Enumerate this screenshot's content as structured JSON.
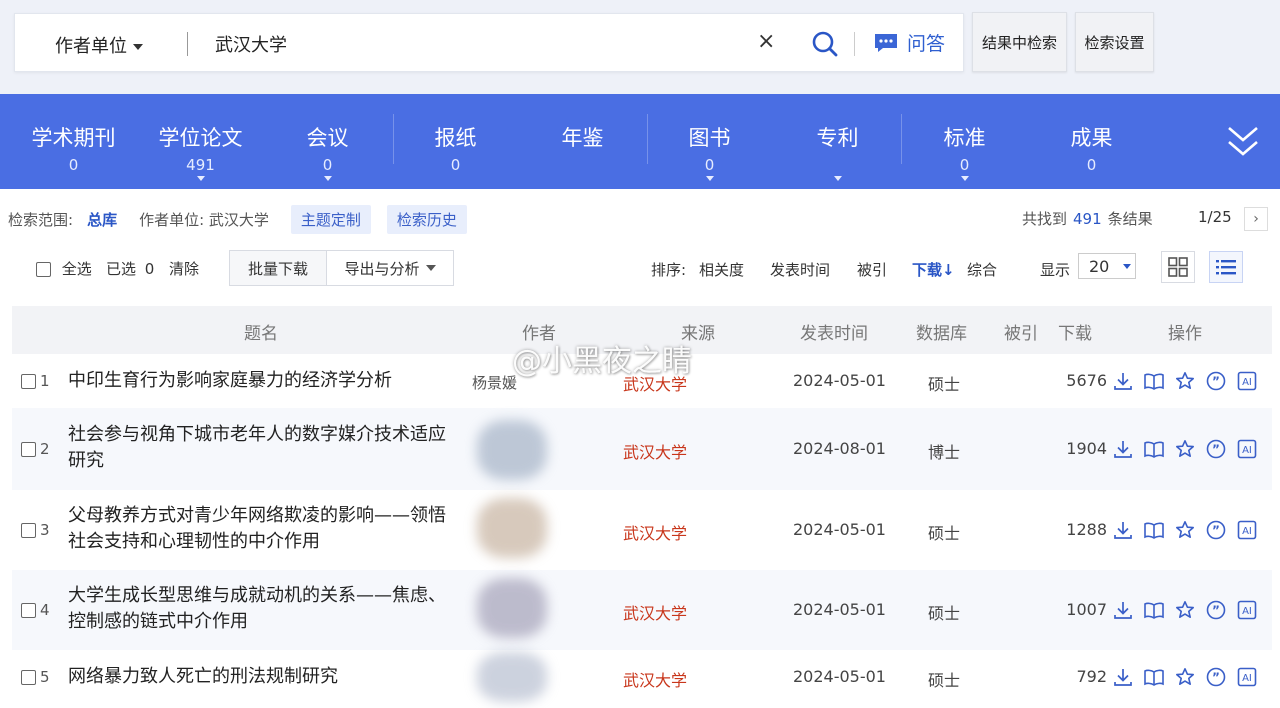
{
  "search": {
    "field": "作者单位",
    "query": "武汉大学",
    "clear_label": "×",
    "qa_label": "问答",
    "within_label": "结果中检索",
    "settings_label": "检索设置"
  },
  "categories": [
    {
      "name": "学术期刊",
      "count": "0"
    },
    {
      "name": "学位论文",
      "count": "491"
    },
    {
      "name": "会议",
      "count": "0"
    },
    {
      "name": "报纸",
      "count": "0"
    },
    {
      "name": "年鉴",
      "count": ""
    },
    {
      "name": "图书",
      "count": "0"
    },
    {
      "name": "专利",
      "count": ""
    },
    {
      "name": "标准",
      "count": "0"
    },
    {
      "name": "成果",
      "count": "0"
    }
  ],
  "filter": {
    "scope_label": "检索范围:",
    "scope_value": "总库",
    "condition": "作者单位: 武汉大学",
    "topic_btn": "主题定制",
    "history_btn": "检索历史",
    "found_prefix": "共找到",
    "found_count": "491",
    "found_suffix": "条结果",
    "page": "1/25",
    "next": "›"
  },
  "toolbar": {
    "select_all": "全选",
    "selected_label": "已选",
    "selected_count": "0",
    "clear": "清除",
    "batch_download": "批量下载",
    "export": "导出与分析",
    "sort_label": "排序:",
    "sort_options": [
      "相关度",
      "发表时间",
      "被引",
      "下载",
      "综合"
    ],
    "sort_arrow": "↓",
    "display_label": "显示",
    "page_size": "20"
  },
  "table": {
    "headers": [
      "题名",
      "作者",
      "来源",
      "发表时间",
      "数据库",
      "被引",
      "下载",
      "操作"
    ],
    "rows": [
      {
        "num": "1",
        "title": "中印生育行为影响家庭暴力的经济学分析",
        "author": "杨景媛",
        "source": "武汉大学",
        "date": "2024-05-01",
        "db": "硕士",
        "downloads": "5676"
      },
      {
        "num": "2",
        "title": "社会参与视角下城市老年人的数字媒介技术适应研究",
        "author": "",
        "source": "武汉大学",
        "date": "2024-08-01",
        "db": "博士",
        "downloads": "1904"
      },
      {
        "num": "3",
        "title": "父母教养方式对青少年网络欺凌的影响——领悟社会支持和心理韧性的中介作用",
        "author": "",
        "source": "武汉大学",
        "date": "2024-05-01",
        "db": "硕士",
        "downloads": "1288"
      },
      {
        "num": "4",
        "title": "大学生成长型思维与成就动机的关系——焦虑、控制感的链式中介作用",
        "author": "",
        "source": "武汉大学",
        "date": "2024-05-01",
        "db": "硕士",
        "downloads": "1007"
      },
      {
        "num": "5",
        "title": "网络暴力致人死亡的刑法规制研究",
        "author": "",
        "source": "武汉大学",
        "date": "2024-05-01",
        "db": "硕士",
        "downloads": "792"
      }
    ]
  },
  "watermark": "@小黑夜之睛",
  "colors": {
    "brand_blue": "#4a6ee3",
    "link_blue": "#2a56c6",
    "source_red": "#c8361b"
  }
}
